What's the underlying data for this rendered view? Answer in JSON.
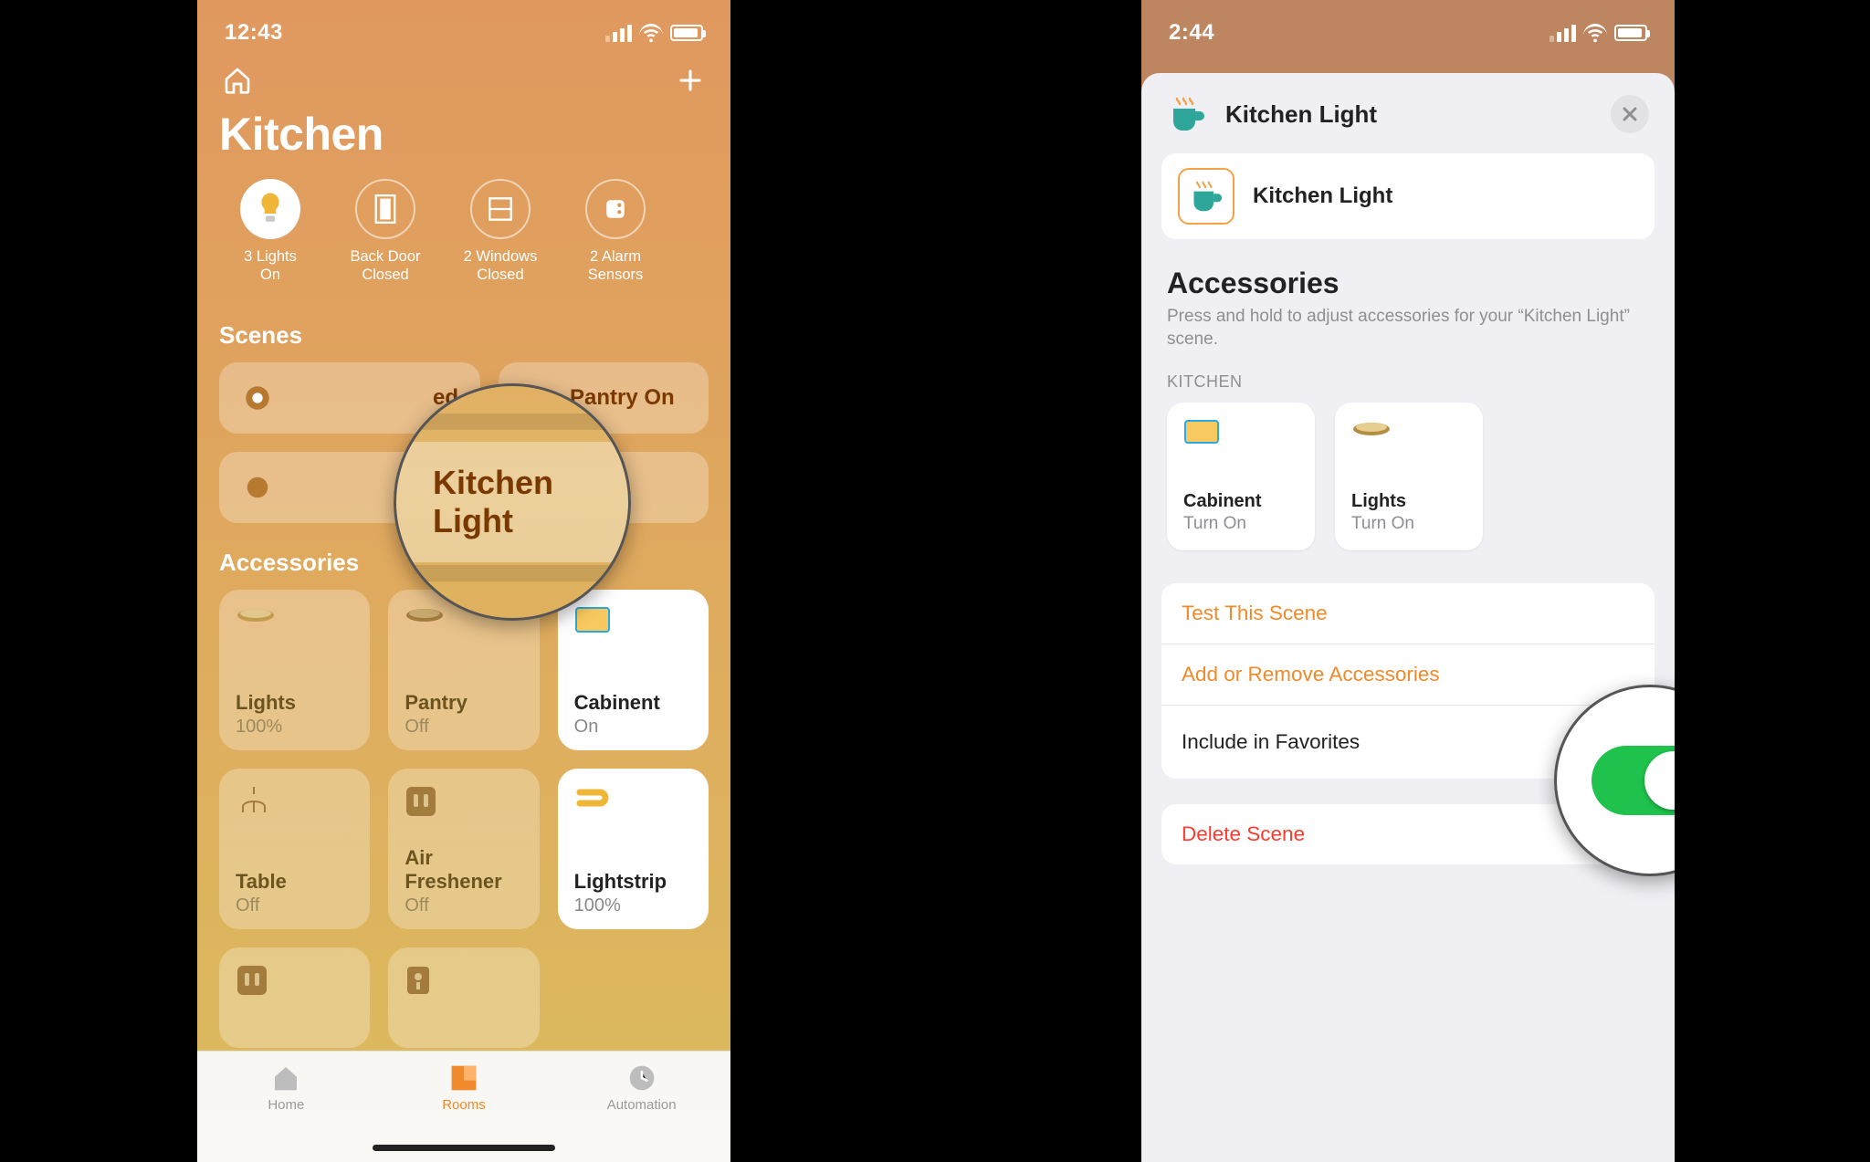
{
  "left": {
    "status_time": "12:43",
    "room_title": "Kitchen",
    "quick": [
      {
        "line1": "3 Lights",
        "line2": "On"
      },
      {
        "line1": "Back Door",
        "line2": "Closed"
      },
      {
        "line1": "2 Windows",
        "line2": "Closed"
      },
      {
        "line1": "2 Alarm",
        "line2": "Sensors"
      }
    ],
    "scenes_header": "Scenes",
    "scenes": {
      "partial": "ed",
      "pantry": "Pantry On"
    },
    "accessories_header": "Accessories",
    "tiles": [
      {
        "name": "Lights",
        "state": "100%"
      },
      {
        "name": "Pantry",
        "state": "Off"
      },
      {
        "name": "Cabinent",
        "state": "On"
      },
      {
        "name": "Table",
        "state": "Off"
      },
      {
        "name": "Air Freshener",
        "state": "Off"
      },
      {
        "name": "Lightstrip",
        "state": "100%"
      }
    ],
    "tabs": {
      "home": "Home",
      "rooms": "Rooms",
      "automation": "Automation"
    },
    "magnified_scene": "Kitchen Light"
  },
  "right": {
    "status_time": "2:44",
    "sheet_title": "Kitchen Light",
    "card_title": "Kitchen Light",
    "section_title": "Accessories",
    "section_sub": "Press and hold to adjust accessories for your “Kitchen Light” scene.",
    "group_label": "KITCHEN",
    "acc": [
      {
        "name": "Cabinent",
        "state": "Turn On"
      },
      {
        "name": "Lights",
        "state": "Turn On"
      }
    ],
    "actions": {
      "test": "Test This Scene",
      "addremove": "Add or Remove Accessories",
      "favorites": "Include in Favorites",
      "delete": "Delete Scene"
    }
  }
}
